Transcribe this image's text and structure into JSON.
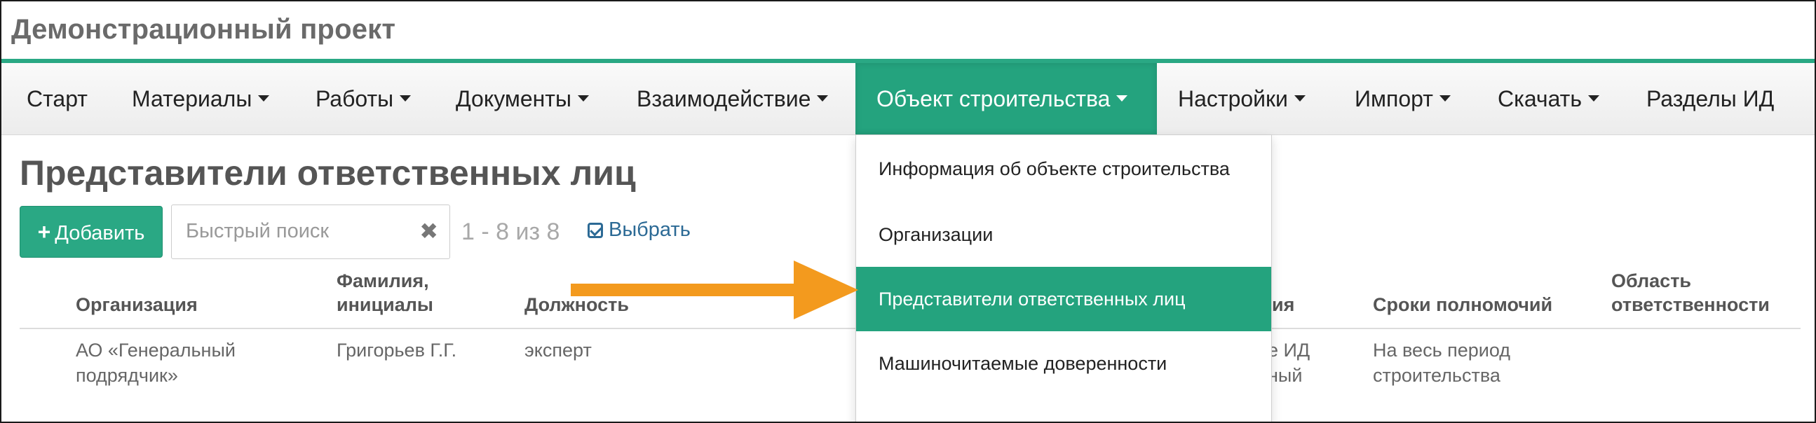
{
  "app": {
    "title": "Демонстрационный проект"
  },
  "nav": {
    "items": [
      {
        "label": "Старт"
      },
      {
        "label": "Материалы"
      },
      {
        "label": "Работы"
      },
      {
        "label": "Документы"
      },
      {
        "label": "Взаимодействие"
      },
      {
        "label": "Объект строительства"
      },
      {
        "label": "Настройки"
      },
      {
        "label": "Импорт"
      },
      {
        "label": "Скачать"
      },
      {
        "label": "Разделы ИД"
      }
    ],
    "active": "Объект строительства"
  },
  "page": {
    "title": "Представители ответственных лиц"
  },
  "toolbar": {
    "add_label": "Добавить",
    "search_placeholder": "Быстрый поиск",
    "pager": "1 - 8 из 8",
    "select_label": "Выбрать"
  },
  "table": {
    "headers": {
      "organization": "Организация",
      "name_l1": "Фамилия,",
      "name_l2": "инициалы",
      "position": "Должность",
      "partial_col": "ия",
      "term": "Сроки полномочий",
      "area_l1": "Область",
      "area_l2": "ответственности"
    },
    "rows": [
      {
        "organization_l1": "АО «Генеральный",
        "organization_l2": "подрядчик»",
        "name": "Григорьев Г.Г.",
        "position": "эксперт",
        "partial_l1": "е ИД",
        "partial_l2": "ный",
        "term_l1": "На весь период",
        "term_l2": "строительства"
      }
    ]
  },
  "dropdown": {
    "items": [
      {
        "label": "Информация об объекте строительства"
      },
      {
        "label": "Организации"
      },
      {
        "label": "Представители ответственных лиц"
      },
      {
        "label": "Машиночитаемые доверенности"
      }
    ],
    "active_index": 2
  },
  "colors": {
    "accent": "#24a37e",
    "arrow": "#f39a1e",
    "link": "#2c6a95"
  }
}
